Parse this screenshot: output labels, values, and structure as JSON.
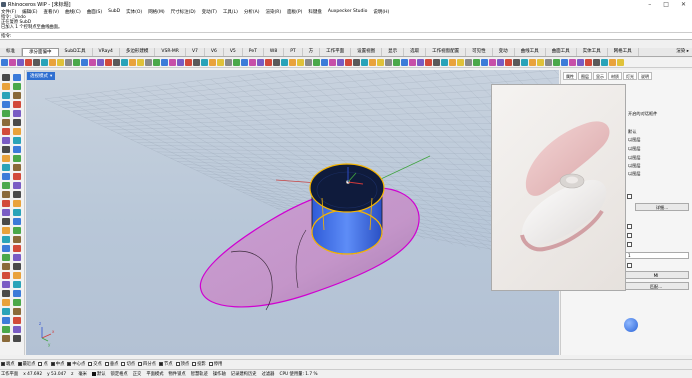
{
  "window": {
    "title": "Rhinoceros WIP - [未标题]",
    "minimize": "–",
    "maximize": "□",
    "close": "✕"
  },
  "menu": [
    "文件(F)",
    "编辑(E)",
    "查看(V)",
    "曲线(C)",
    "曲面(S)",
    "SubD",
    "实体(O)",
    "网格(M)",
    "尺寸标注(D)",
    "变动(T)",
    "工具(L)",
    "分析(A)",
    "渲染(R)",
    "面板(P)",
    "科键盘",
    "Auxpecker Studio",
    "说明(H)"
  ],
  "command_history": [
    "指令: _Undo",
    "正在复原 SubD",
    "已加入 1 个控制点至曲线曲面。",
    "指令:"
  ],
  "command_prompt": "指令:",
  "tabs": [
    "标准",
    "承分面偏中",
    "SubD工具",
    "VRay4",
    "多边形建模",
    "VSR-MR",
    "V7",
    "V6",
    "V5",
    "PeT",
    "W8",
    "PT",
    "方",
    "工作平面",
    "设置视图",
    "显示",
    "选取",
    "工作视窗配置",
    "可见性",
    "变动",
    "曲线工具",
    "曲面工具",
    "实体工具",
    "网格工具",
    "渲染",
    "工具"
  ],
  "tabs_active_index": 1,
  "tabs_more": "渲染 ▸",
  "viewport": {
    "title": "透视模式",
    "caret": "▾"
  },
  "right_panel": {
    "tabs": [
      "属性",
      "图层",
      "显示",
      "材质",
      "灯光",
      "说明"
    ],
    "rows": [
      "开启的对话框件",
      "默认",
      "以图层",
      "以图层",
      "以图层",
      "以图层",
      "以图层"
    ],
    "field_value": "1",
    "buttons": [
      "详细...",
      "MI",
      "匹配..."
    ]
  },
  "osnaps": [
    {
      "label": "端点",
      "on": true
    },
    {
      "label": "最近点",
      "on": true
    },
    {
      "label": "点",
      "on": false
    },
    {
      "label": "中点",
      "on": true
    },
    {
      "label": "中心点",
      "on": true
    },
    {
      "label": "交点",
      "on": false
    },
    {
      "label": "垂点",
      "on": false
    },
    {
      "label": "切点",
      "on": false
    },
    {
      "label": "四分点",
      "on": false
    },
    {
      "label": "节点",
      "on": true
    },
    {
      "label": "顶点",
      "on": false
    },
    {
      "label": "投影",
      "on": false
    },
    {
      "label": "停用",
      "on": false
    }
  ],
  "status": {
    "cplane": "工作平面",
    "x": "x 47.692",
    "y": "y 53.047",
    "z": "z",
    "units": "毫米",
    "layer": "默认",
    "items": [
      "锁定格点",
      "正交",
      "平面模式",
      "物件锁点",
      "智慧轨迹",
      "操作轴",
      "记录建构历史",
      "过滤器",
      "CPU 使用量: 1.7 %"
    ]
  },
  "colors": {
    "accent": "#2f6fd1",
    "viewport_bg": "#bfcbd9",
    "grid": "#8a96a6",
    "surface": "#c59ad0",
    "surface_edge": "#d000d0",
    "selection": "#f5b400",
    "axis_x": "#d23a3a",
    "axis_y": "#3fa33f",
    "axis_z": "#2f4fd1"
  }
}
